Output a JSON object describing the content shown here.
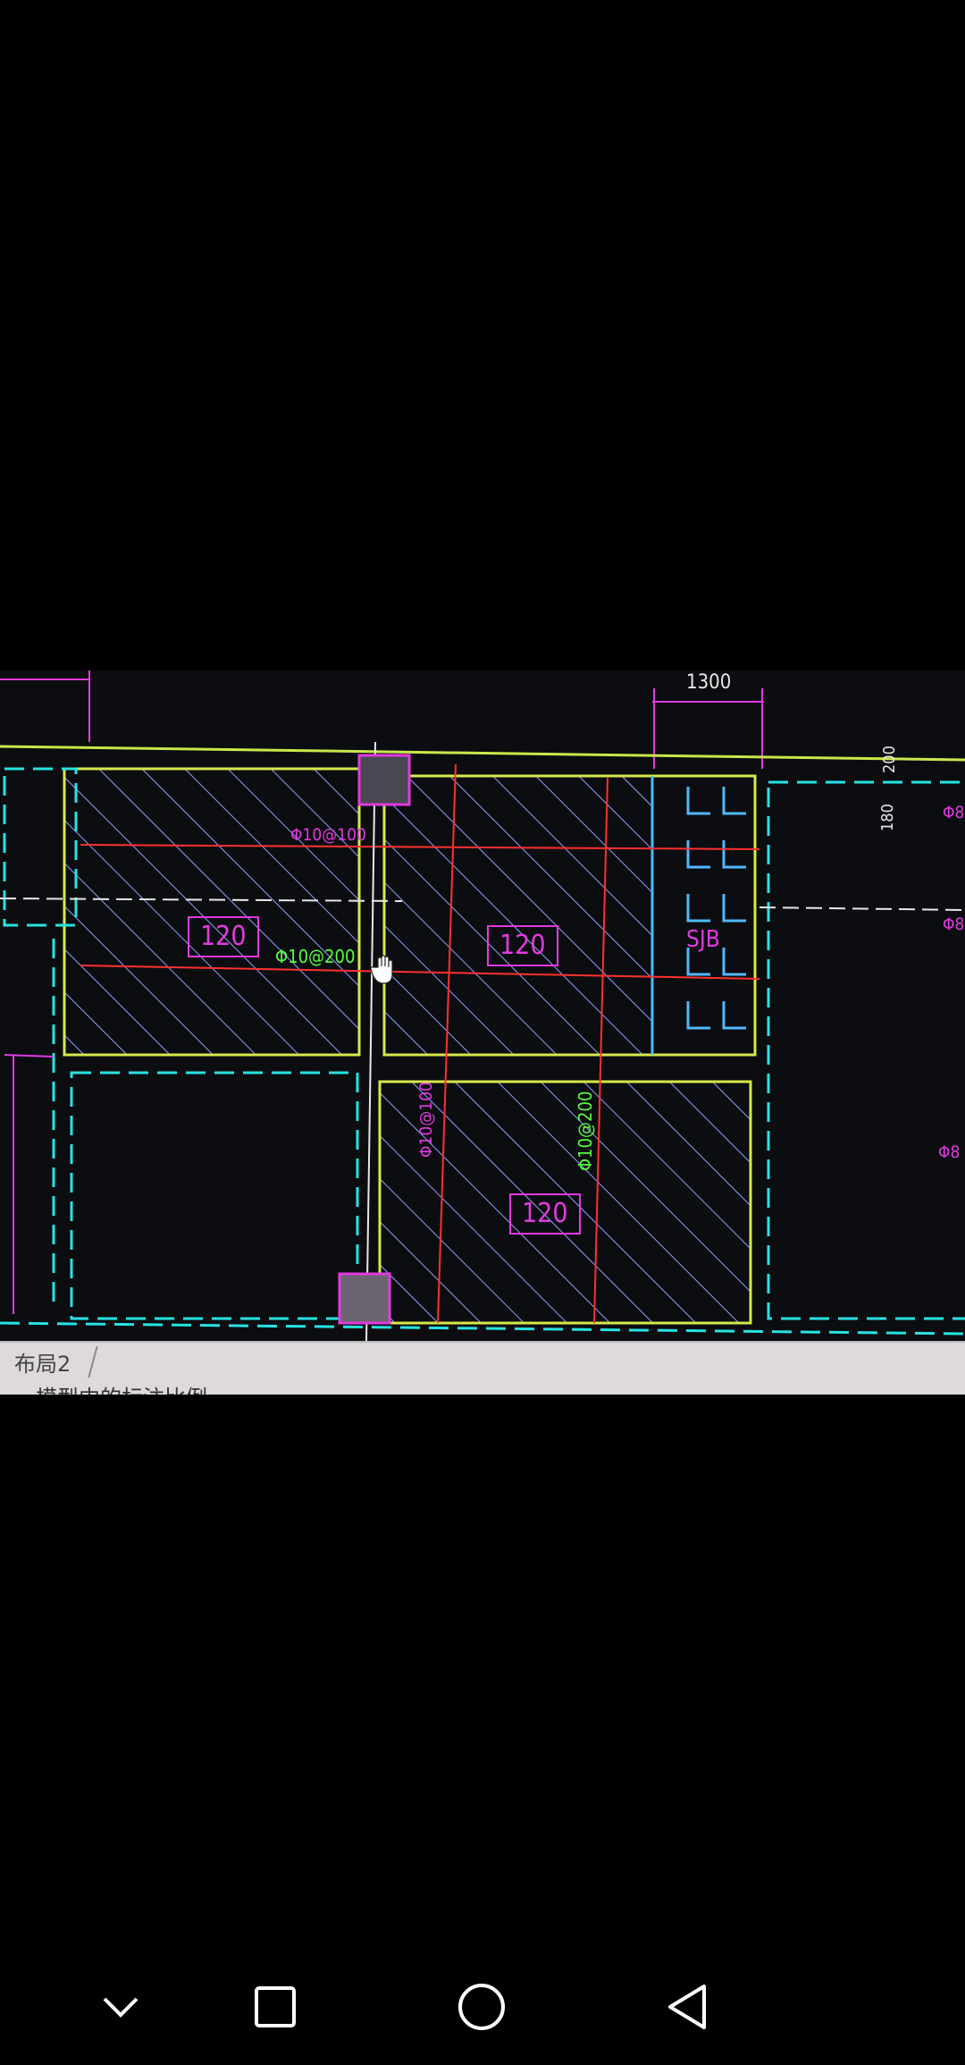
{
  "cad_drawing": {
    "dimension_top": "1300",
    "dimension_side_200": "200",
    "dimension_side_180": "180",
    "slab_tags": [
      "120",
      "120",
      "120"
    ],
    "rebar_labels_magenta": [
      "Φ10@100",
      "Φ10@100"
    ],
    "rebar_labels_green": [
      "Φ10@200",
      "Φ10@200"
    ],
    "stair_label": "SJB",
    "right_edge_labels": [
      "Φ8",
      "Φ8",
      "Φ8"
    ]
  },
  "status_bar": {
    "layout_tab": "布局2",
    "command_line": "模型中的标注比例"
  },
  "nav": {
    "icons": [
      "chevron-down-icon",
      "recents-square-icon",
      "home-circle-icon",
      "back-triangle-icon"
    ]
  },
  "colors": {
    "cyan": "#27e3e3",
    "yellow": "#d6e84a",
    "magenta": "#e23ae0",
    "red": "#ff3030",
    "hatch": "#8fa0ff",
    "green": "#55ff40"
  }
}
